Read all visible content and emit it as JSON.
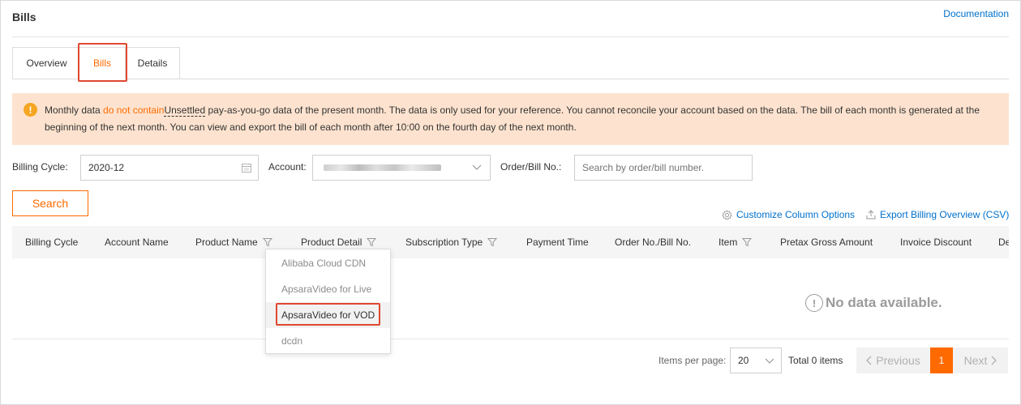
{
  "header": {
    "title": "Bills",
    "documentation_link": "Documentation"
  },
  "tabs": [
    {
      "label": "Overview"
    },
    {
      "label": "Bills",
      "active": true
    },
    {
      "label": "Details"
    }
  ],
  "notice": {
    "prefix": "Monthly data ",
    "warning": "do not contain",
    "underlined": "Unsettled",
    "line1_rest": " pay-as-you-go data of the present month. The data is only used for your reference. You cannot reconcile your account based on the data. The bill of each month is generated at the",
    "line2": "beginning of the next month. You can view and export the bill of each month after 10:00 on the fourth day of the next month."
  },
  "filters": {
    "billing_cycle_label": "Billing Cycle:",
    "billing_cycle_value": "2020-12",
    "account_label": "Account:",
    "order_label": "Order/Bill No.:",
    "order_placeholder": "Search by order/bill number.",
    "search_button": "Search"
  },
  "actions": {
    "customize": "Customize Column Options",
    "export": "Export Billing Overview (CSV)"
  },
  "table": {
    "columns": [
      "Billing Cycle",
      "Account Name",
      "Product Name",
      "Product Detail",
      "Subscription Type",
      "Payment Time",
      "Order No./Bill No.",
      "Item",
      "Pretax Gross Amount",
      "Invoice Discount",
      "De"
    ],
    "empty_text": "No data available."
  },
  "product_filter_dropdown": {
    "options": [
      "Alibaba Cloud CDN",
      "ApsaraVideo for Live",
      "ApsaraVideo for VOD",
      "dcdn"
    ],
    "selected": "ApsaraVideo for VOD"
  },
  "pagination": {
    "items_per_page_label": "Items per page:",
    "items_per_page_value": "20",
    "total": "Total 0 items",
    "previous": "Previous",
    "current_page": "1",
    "next": "Next"
  },
  "colors": {
    "accent": "#ff6a00",
    "link": "#0070cc",
    "notice_bg": "#fde3cf",
    "highlight": "#e0482f"
  }
}
